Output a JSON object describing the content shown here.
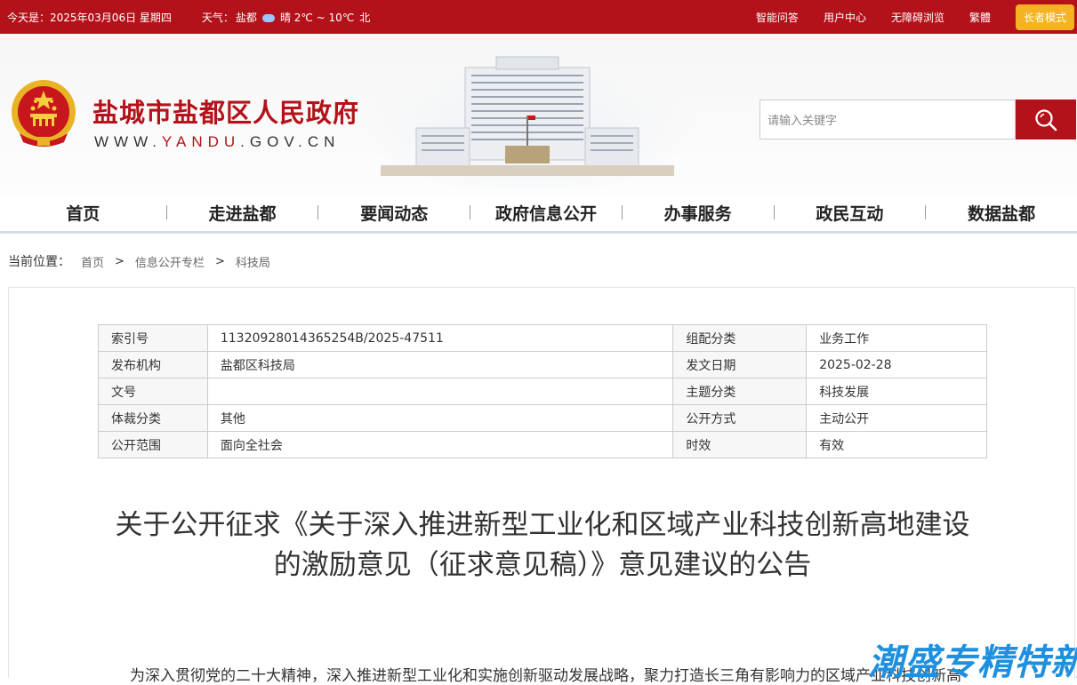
{
  "topbar": {
    "date_label": "今天是：2025年03月06日 星期四",
    "weather_label": "天气：",
    "weather_city": "盐都",
    "weather_value": "晴 2℃ ~ 10℃",
    "weather_extra": "北",
    "links": [
      "智能问答",
      "用户中心",
      "无障碍浏览",
      "繁體"
    ],
    "elder_mode": "长者模式"
  },
  "header": {
    "site_title": "盐城市盐都区人民政府",
    "url_prefix": "WWW.",
    "url_highlight": "YANDU",
    "url_suffix": ".GOV.CN",
    "search_placeholder": "请输入关键字"
  },
  "nav": [
    "首页",
    "走进盐都",
    "要闻动态",
    "政府信息公开",
    "办事服务",
    "政民互动",
    "数据盐都"
  ],
  "breadcrumb": {
    "label": "当前位置：",
    "items": [
      "首页",
      "信息公开专栏",
      "科技局"
    ],
    "separator": ">"
  },
  "meta": [
    {
      "k1": "索引号",
      "v1": "11320928014365254B/2025-47511",
      "k2": "组配分类",
      "v2": "业务工作"
    },
    {
      "k1": "发布机构",
      "v1": "盐都区科技局",
      "k2": "发文日期",
      "v2": "2025-02-28"
    },
    {
      "k1": "文号",
      "v1": "",
      "k2": "主题分类",
      "v2": "科技发展"
    },
    {
      "k1": "体裁分类",
      "v1": "其他",
      "k2": "公开方式",
      "v2": "主动公开"
    },
    {
      "k1": "公开范围",
      "v1": "面向全社会",
      "k2": "时效",
      "v2": "有效"
    }
  ],
  "article": {
    "title_line1": "关于公开征求《关于深入推进新型工业化和区域产业科技创新高地建设",
    "title_line2": "的激励意见（征求意见稿）》意见建议的公告",
    "body_start": "为深入贯彻党的二十大精神，深入推进新型工业化和实施创新驱动发展战略，聚力打造长三角有影响力的区域产业科技创新高"
  },
  "watermark": "潮盛专精特新",
  "colors": {
    "brand_red": "#b4121a",
    "elder_btn": "#f5b324",
    "watermark": "#1e90e0"
  }
}
